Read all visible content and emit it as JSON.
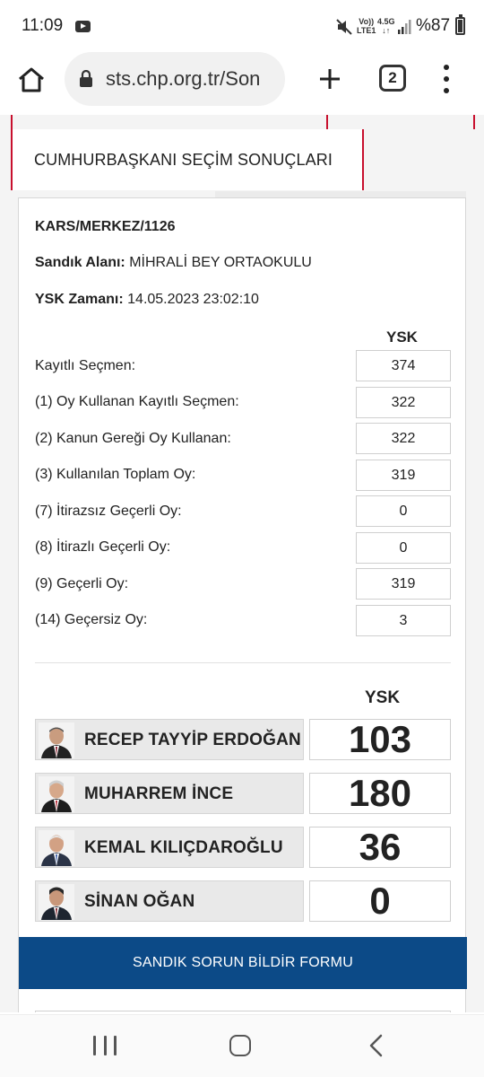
{
  "status_bar": {
    "time": "11:09",
    "network_top": "Vo))",
    "network_bottom": "LTE1",
    "speed_top": "4.5G",
    "speed_bottom": "↓↑",
    "battery": "%87",
    "icons": [
      "youtube-icon",
      "mute-icon",
      "signal-icon",
      "battery-icon"
    ]
  },
  "browser": {
    "url": "sts.chp.org.tr/Son",
    "tab_count": "2",
    "icons": [
      "home-icon",
      "lock-icon",
      "plus-icon",
      "tabs-icon",
      "menu-icon"
    ]
  },
  "page": {
    "section_title": "CUMHURBAŞKANI SEÇİM SONUÇLARI",
    "location": "KARS/MERKEZ/1126",
    "sandik_label": "Sandık Alanı:",
    "sandik_value": "MİHRALİ BEY ORTAOKULU",
    "ysk_time_label": "YSK Zamanı:",
    "ysk_time_value": "14.05.2023 23:02:10",
    "stats_header": "YSK",
    "stats": [
      {
        "label": "Kayıtlı Seçmen:",
        "value": "374"
      },
      {
        "label": "(1) Oy Kullanan Kayıtlı Seçmen:",
        "value": "322"
      },
      {
        "label": "(2) Kanun Gereği Oy Kullanan:",
        "value": "322"
      },
      {
        "label": "(3) Kullanılan Toplam Oy:",
        "value": "319"
      },
      {
        "label": "(7) İtirazsız Geçerli Oy:",
        "value": "0"
      },
      {
        "label": "(8) İtirazlı Geçerli Oy:",
        "value": "0"
      },
      {
        "label": "(9) Geçerli Oy:",
        "value": "319"
      },
      {
        "label": "(14) Geçersiz Oy:",
        "value": "3"
      }
    ],
    "candidates_header": "YSK",
    "candidates": [
      {
        "name": "RECEP TAYYİP ERDOĞAN",
        "votes": "103"
      },
      {
        "name": "MUHARREM İNCE",
        "votes": "180"
      },
      {
        "name": "KEMAL KILIÇDAROĞLU",
        "votes": "36"
      },
      {
        "name": "SİNAN OĞAN",
        "votes": "0"
      }
    ],
    "form_button": "SANDIK SORUN BİLDİR FORMU"
  },
  "colors": {
    "accent_red": "#c8102e",
    "form_blue": "#0c4a87"
  }
}
